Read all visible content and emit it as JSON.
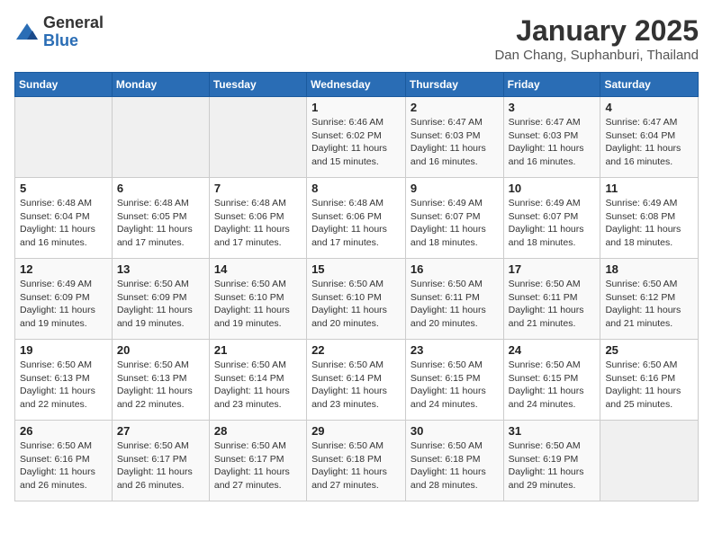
{
  "logo": {
    "general": "General",
    "blue": "Blue"
  },
  "header": {
    "month": "January 2025",
    "location": "Dan Chang, Suphanburi, Thailand"
  },
  "weekdays": [
    "Sunday",
    "Monday",
    "Tuesday",
    "Wednesday",
    "Thursday",
    "Friday",
    "Saturday"
  ],
  "weeks": [
    [
      {
        "day": "",
        "info": ""
      },
      {
        "day": "",
        "info": ""
      },
      {
        "day": "",
        "info": ""
      },
      {
        "day": "1",
        "info": "Sunrise: 6:46 AM\nSunset: 6:02 PM\nDaylight: 11 hours and 15 minutes."
      },
      {
        "day": "2",
        "info": "Sunrise: 6:47 AM\nSunset: 6:03 PM\nDaylight: 11 hours and 16 minutes."
      },
      {
        "day": "3",
        "info": "Sunrise: 6:47 AM\nSunset: 6:03 PM\nDaylight: 11 hours and 16 minutes."
      },
      {
        "day": "4",
        "info": "Sunrise: 6:47 AM\nSunset: 6:04 PM\nDaylight: 11 hours and 16 minutes."
      }
    ],
    [
      {
        "day": "5",
        "info": "Sunrise: 6:48 AM\nSunset: 6:04 PM\nDaylight: 11 hours and 16 minutes."
      },
      {
        "day": "6",
        "info": "Sunrise: 6:48 AM\nSunset: 6:05 PM\nDaylight: 11 hours and 17 minutes."
      },
      {
        "day": "7",
        "info": "Sunrise: 6:48 AM\nSunset: 6:06 PM\nDaylight: 11 hours and 17 minutes."
      },
      {
        "day": "8",
        "info": "Sunrise: 6:48 AM\nSunset: 6:06 PM\nDaylight: 11 hours and 17 minutes."
      },
      {
        "day": "9",
        "info": "Sunrise: 6:49 AM\nSunset: 6:07 PM\nDaylight: 11 hours and 18 minutes."
      },
      {
        "day": "10",
        "info": "Sunrise: 6:49 AM\nSunset: 6:07 PM\nDaylight: 11 hours and 18 minutes."
      },
      {
        "day": "11",
        "info": "Sunrise: 6:49 AM\nSunset: 6:08 PM\nDaylight: 11 hours and 18 minutes."
      }
    ],
    [
      {
        "day": "12",
        "info": "Sunrise: 6:49 AM\nSunset: 6:09 PM\nDaylight: 11 hours and 19 minutes."
      },
      {
        "day": "13",
        "info": "Sunrise: 6:50 AM\nSunset: 6:09 PM\nDaylight: 11 hours and 19 minutes."
      },
      {
        "day": "14",
        "info": "Sunrise: 6:50 AM\nSunset: 6:10 PM\nDaylight: 11 hours and 19 minutes."
      },
      {
        "day": "15",
        "info": "Sunrise: 6:50 AM\nSunset: 6:10 PM\nDaylight: 11 hours and 20 minutes."
      },
      {
        "day": "16",
        "info": "Sunrise: 6:50 AM\nSunset: 6:11 PM\nDaylight: 11 hours and 20 minutes."
      },
      {
        "day": "17",
        "info": "Sunrise: 6:50 AM\nSunset: 6:11 PM\nDaylight: 11 hours and 21 minutes."
      },
      {
        "day": "18",
        "info": "Sunrise: 6:50 AM\nSunset: 6:12 PM\nDaylight: 11 hours and 21 minutes."
      }
    ],
    [
      {
        "day": "19",
        "info": "Sunrise: 6:50 AM\nSunset: 6:13 PM\nDaylight: 11 hours and 22 minutes."
      },
      {
        "day": "20",
        "info": "Sunrise: 6:50 AM\nSunset: 6:13 PM\nDaylight: 11 hours and 22 minutes."
      },
      {
        "day": "21",
        "info": "Sunrise: 6:50 AM\nSunset: 6:14 PM\nDaylight: 11 hours and 23 minutes."
      },
      {
        "day": "22",
        "info": "Sunrise: 6:50 AM\nSunset: 6:14 PM\nDaylight: 11 hours and 23 minutes."
      },
      {
        "day": "23",
        "info": "Sunrise: 6:50 AM\nSunset: 6:15 PM\nDaylight: 11 hours and 24 minutes."
      },
      {
        "day": "24",
        "info": "Sunrise: 6:50 AM\nSunset: 6:15 PM\nDaylight: 11 hours and 24 minutes."
      },
      {
        "day": "25",
        "info": "Sunrise: 6:50 AM\nSunset: 6:16 PM\nDaylight: 11 hours and 25 minutes."
      }
    ],
    [
      {
        "day": "26",
        "info": "Sunrise: 6:50 AM\nSunset: 6:16 PM\nDaylight: 11 hours and 26 minutes."
      },
      {
        "day": "27",
        "info": "Sunrise: 6:50 AM\nSunset: 6:17 PM\nDaylight: 11 hours and 26 minutes."
      },
      {
        "day": "28",
        "info": "Sunrise: 6:50 AM\nSunset: 6:17 PM\nDaylight: 11 hours and 27 minutes."
      },
      {
        "day": "29",
        "info": "Sunrise: 6:50 AM\nSunset: 6:18 PM\nDaylight: 11 hours and 27 minutes."
      },
      {
        "day": "30",
        "info": "Sunrise: 6:50 AM\nSunset: 6:18 PM\nDaylight: 11 hours and 28 minutes."
      },
      {
        "day": "31",
        "info": "Sunrise: 6:50 AM\nSunset: 6:19 PM\nDaylight: 11 hours and 29 minutes."
      },
      {
        "day": "",
        "info": ""
      }
    ]
  ]
}
